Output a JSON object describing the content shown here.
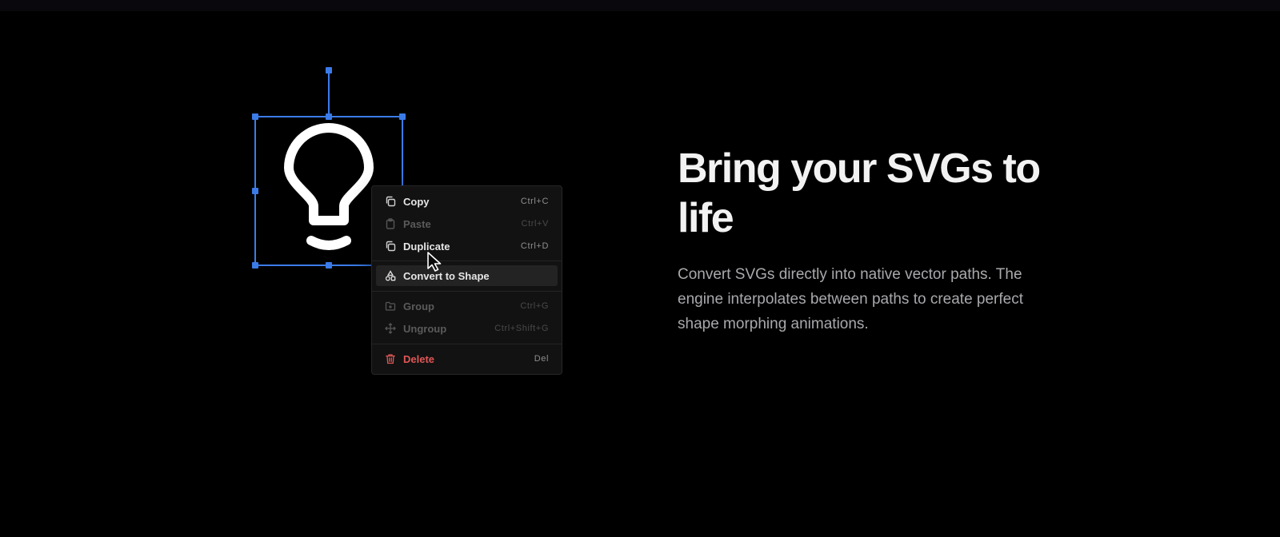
{
  "hero": {
    "title": "Bring your SVGs to life",
    "body": "Convert SVGs directly into native vector paths. The engine interpolates between paths to create perfect shape morphing animations."
  },
  "canvas": {
    "selected_shape_icon": "lightbulb-icon",
    "selection_color": "#3b7be8"
  },
  "context_menu": {
    "items": [
      {
        "label": "Copy",
        "shortcut": "Ctrl+C",
        "icon": "copy-icon",
        "state": "enabled"
      },
      {
        "label": "Paste",
        "shortcut": "Ctrl+V",
        "icon": "clipboard-icon",
        "state": "disabled"
      },
      {
        "label": "Duplicate",
        "shortcut": "Ctrl+D",
        "icon": "duplicate-icon",
        "state": "enabled"
      },
      {
        "label": "Convert to Shape",
        "shortcut": "",
        "icon": "shapes-icon",
        "state": "highlighted"
      },
      {
        "label": "Group",
        "shortcut": "Ctrl+G",
        "icon": "folder-plus-icon",
        "state": "disabled"
      },
      {
        "label": "Ungroup",
        "shortcut": "Ctrl+Shift+G",
        "icon": "move-arrows-icon",
        "state": "disabled"
      },
      {
        "label": "Delete",
        "shortcut": "Del",
        "icon": "trash-icon",
        "state": "danger"
      }
    ],
    "colors": {
      "danger": "#e05656",
      "highlight": "#232323"
    }
  }
}
